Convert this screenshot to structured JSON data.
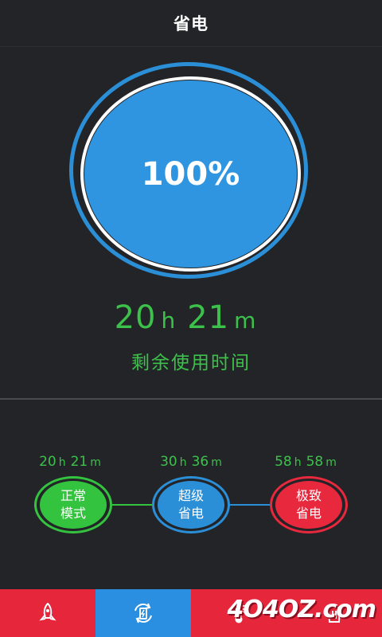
{
  "header": {
    "title": "省电"
  },
  "battery": {
    "percent_label": "100%",
    "percent": 100
  },
  "remaining": {
    "hours": "20",
    "hours_unit": "h",
    "minutes": "21",
    "minutes_unit": "m",
    "label": "剩余使用时间"
  },
  "modes": [
    {
      "time_h": "20",
      "time_m": "21",
      "line1": "正常",
      "line2": "模式",
      "color": "#34c33f"
    },
    {
      "time_h": "30",
      "time_m": "36",
      "line1": "超级",
      "line2": "省电",
      "color": "#2b8fd8"
    },
    {
      "time_h": "58",
      "time_m": "58",
      "line1": "极致",
      "line2": "省电",
      "color": "#e8283c"
    }
  ],
  "units": {
    "h": "h",
    "m": "m"
  },
  "nav": {
    "items": [
      {
        "icon": "rocket-icon"
      },
      {
        "icon": "battery-cycle-icon",
        "active": true
      },
      {
        "icon": "thermometer-icon"
      },
      {
        "icon": "trash-icon"
      }
    ],
    "active_color": "#2a8fe0",
    "bar_color": "#e5263b"
  },
  "watermark": "4O4OZ.com"
}
